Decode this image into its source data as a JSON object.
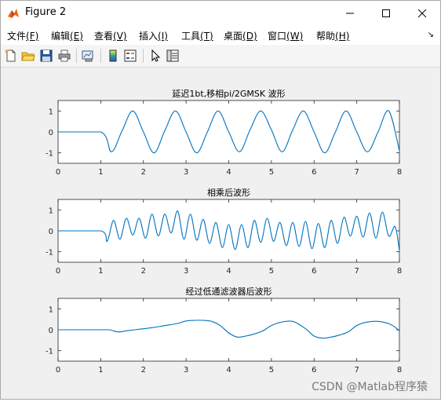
{
  "window": {
    "title": "Figure 2",
    "icon": "matlab-figure-icon",
    "controls": [
      "minimize-icon",
      "maximize-icon",
      "close-icon"
    ]
  },
  "menu": [
    {
      "label": "文件",
      "key": "(F)"
    },
    {
      "label": "编辑",
      "key": "(E)"
    },
    {
      "label": "查看",
      "key": "(V)"
    },
    {
      "label": "插入",
      "key": "(I)"
    },
    {
      "label": "工具",
      "key": "(T)"
    },
    {
      "label": "桌面",
      "key": "(D)"
    },
    {
      "label": "窗口",
      "key": "(W)"
    },
    {
      "label": "帮助",
      "key": "(H)"
    }
  ],
  "menu_overflow": "↘",
  "toolbar": [
    "new-figure-icon",
    "open-file-icon",
    "save-icon",
    "print-icon",
    "link-plot-icon",
    "insert-colorbar-icon",
    "insert-legend-icon",
    "edit-plot-icon",
    "property-inspector-icon"
  ],
  "colors": {
    "line": "#0072bd",
    "axes_bg": "#ffffff",
    "figure_bg": "#f0f0f0"
  },
  "watermark": "CSDN @Matlab程序猿",
  "chart_data": [
    {
      "type": "line",
      "title": "延迟1bt,移相pi/2GMSK 波形",
      "xlim": [
        0,
        8
      ],
      "ylim": [
        -1.5,
        1.5
      ],
      "xticks": [
        0,
        1,
        2,
        3,
        4,
        5,
        6,
        7,
        8
      ],
      "yticks": [
        -1,
        0,
        1
      ],
      "series": [
        {
          "x": [
            0,
            1,
            1.25,
            1.5,
            1.75,
            2,
            2.25,
            2.5,
            2.75,
            3,
            3.25,
            3.5,
            3.75,
            4,
            4.25,
            4.5,
            4.75,
            5,
            5.25,
            5.5,
            5.75,
            6,
            6.25,
            6.5,
            6.75,
            7,
            7.25,
            7.5,
            7.75,
            8
          ],
          "y": [
            0,
            0,
            -0.95,
            0.05,
            1,
            0,
            -1,
            0.05,
            1,
            0,
            -1,
            0,
            1,
            0,
            -0.95,
            0.1,
            1,
            0.1,
            -0.95,
            0.1,
            1,
            0,
            -1,
            0,
            1,
            0,
            -0.95,
            0,
            1,
            -0.9
          ]
        }
      ]
    },
    {
      "type": "line",
      "title": "相乘后波形",
      "xlim": [
        0,
        8
      ],
      "ylim": [
        -1.5,
        1.5
      ],
      "xticks": [
        0,
        1,
        2,
        3,
        4,
        5,
        6,
        7,
        8
      ],
      "yticks": [
        -1,
        0,
        1
      ],
      "series": [
        {
          "x": [
            0,
            1,
            1.15,
            1.3,
            1.45,
            1.6,
            1.75,
            1.9,
            2.05,
            2.2,
            2.35,
            2.5,
            2.65,
            2.8,
            2.95,
            3.1,
            3.25,
            3.4,
            3.55,
            3.7,
            3.85,
            4.0,
            4.15,
            4.3,
            4.45,
            4.6,
            4.75,
            4.9,
            5.05,
            5.2,
            5.35,
            5.5,
            5.65,
            5.8,
            5.95,
            6.1,
            6.25,
            6.4,
            6.55,
            6.7,
            6.85,
            7.0,
            7.15,
            7.3,
            7.45,
            7.6,
            7.75,
            7.9,
            8
          ],
          "y": [
            0,
            0,
            -0.5,
            0.5,
            -0.4,
            0.6,
            -0.2,
            0.6,
            -0.35,
            0.8,
            -0.25,
            0.8,
            -0.1,
            0.95,
            -0.4,
            0.8,
            -0.45,
            0.55,
            -0.6,
            0.4,
            -0.8,
            0.3,
            -0.9,
            0.3,
            -0.8,
            0.5,
            -0.55,
            0.6,
            -0.5,
            0.4,
            -0.7,
            0.4,
            -0.75,
            0.45,
            -0.85,
            0.35,
            -0.8,
            0.5,
            -0.6,
            0.65,
            -0.25,
            0.7,
            -0.3,
            0.85,
            -0.35,
            0.9,
            -0.25,
            0.2,
            -0.95
          ]
        }
      ]
    },
    {
      "type": "line",
      "title": "经过低通滤波器后波形",
      "xlim": [
        0,
        8
      ],
      "ylim": [
        -1.5,
        1.5
      ],
      "xticks": [
        0,
        1,
        2,
        3,
        4,
        5,
        6,
        7,
        8
      ],
      "yticks": [
        -1,
        0,
        1
      ],
      "series": [
        {
          "x": [
            0,
            1,
            1.2,
            1.4,
            1.6,
            1.8,
            2.0,
            2.2,
            2.5,
            2.8,
            3.0,
            3.2,
            3.4,
            3.6,
            3.8,
            4.0,
            4.2,
            4.4,
            4.6,
            4.8,
            5.0,
            5.2,
            5.5,
            5.8,
            6.0,
            6.2,
            6.4,
            6.6,
            6.8,
            7.0,
            7.2,
            7.5,
            7.8,
            8
          ],
          "y": [
            0,
            0,
            0,
            -0.1,
            -0.05,
            0,
            0.05,
            0.1,
            0.2,
            0.3,
            0.42,
            0.45,
            0.45,
            0.4,
            0.2,
            -0.15,
            -0.35,
            -0.3,
            -0.2,
            -0.05,
            0.2,
            0.35,
            0.4,
            0.05,
            -0.3,
            -0.4,
            -0.35,
            -0.25,
            -0.1,
            0.2,
            0.35,
            0.4,
            0.25,
            -0.05
          ]
        }
      ]
    }
  ]
}
